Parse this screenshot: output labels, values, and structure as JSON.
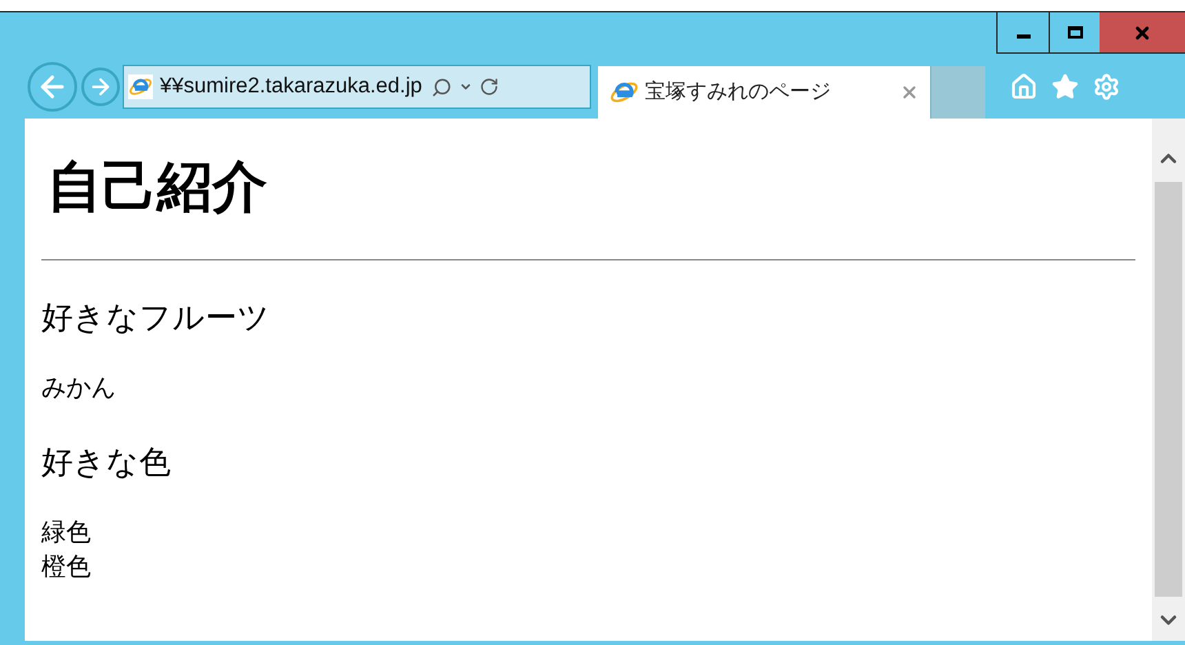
{
  "address_bar": {
    "value": "¥¥sumire2.takarazuka.ed.jp"
  },
  "tabs": [
    {
      "title": "宝塚すみれのページ",
      "selected": true
    }
  ],
  "page": {
    "title": "自己紹介",
    "sections": [
      {
        "heading": "好きなフルーツ",
        "lines": [
          "みかん"
        ]
      },
      {
        "heading": "好きな色",
        "lines": [
          "緑色",
          "橙色"
        ]
      }
    ]
  }
}
